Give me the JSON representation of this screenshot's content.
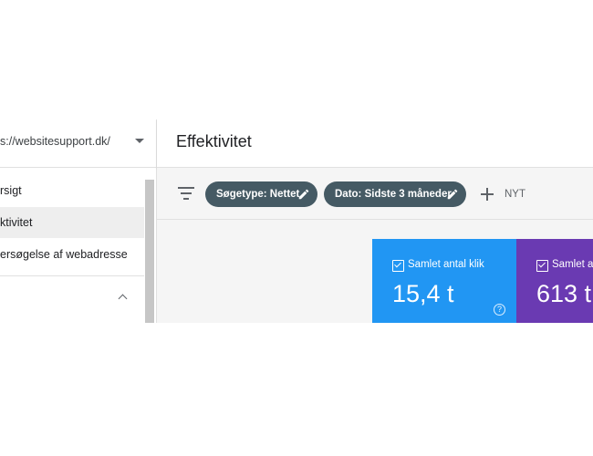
{
  "sidebar": {
    "property": "s://websitesupport.dk/",
    "items": [
      {
        "label": "rsigt"
      },
      {
        "label": "ktivitet"
      },
      {
        "label": "ersøgelse af webadresse"
      }
    ]
  },
  "header": {
    "title": "Effektivitet"
  },
  "filters": {
    "chips": [
      {
        "label": "Søgetype: Nettet"
      },
      {
        "label": "Dato: Sidste 3 måneder"
      }
    ],
    "add_label": "NYT"
  },
  "metrics": [
    {
      "label": "Samlet antal klik",
      "value": "15,4 t",
      "color": "#2196f3",
      "help": "?"
    },
    {
      "label": "Samlet a",
      "value": "613 t",
      "color": "#6a3ab2"
    }
  ],
  "colors": {
    "chip": "#455a64",
    "active_nav": "#eeeeee"
  }
}
